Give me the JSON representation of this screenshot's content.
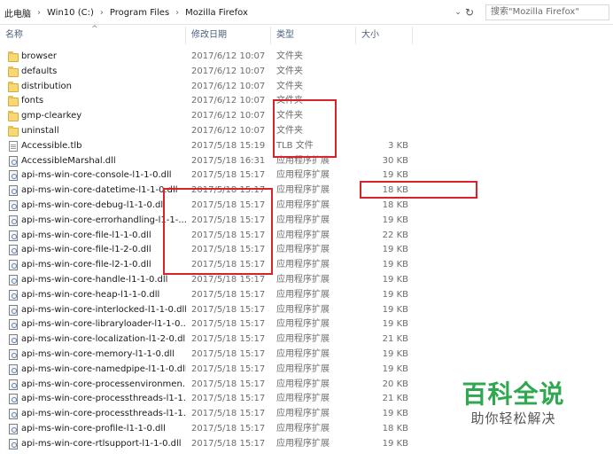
{
  "address_bar": {
    "breadcrumbs": [
      "此电脑",
      "Win10 (C:)",
      "Program Files",
      "Mozilla Firefox"
    ],
    "separator": "›",
    "dropdown_icon": "chevron-down-icon",
    "refresh_icon": "refresh-icon",
    "search_placeholder": "搜索\"Mozilla Firefox\""
  },
  "columns": {
    "name": "名称",
    "date": "修改日期",
    "type": "类型",
    "size": "大小",
    "sort_indicator": "^"
  },
  "files": [
    {
      "icon": "folder-icon",
      "name": "browser",
      "date": "2017/6/12 10:07",
      "type": "文件夹",
      "size": ""
    },
    {
      "icon": "folder-icon",
      "name": "defaults",
      "date": "2017/6/12 10:07",
      "type": "文件夹",
      "size": ""
    },
    {
      "icon": "folder-icon",
      "name": "distribution",
      "date": "2017/6/12 10:07",
      "type": "文件夹",
      "size": ""
    },
    {
      "icon": "folder-icon",
      "name": "fonts",
      "date": "2017/6/12 10:07",
      "type": "文件夹",
      "size": ""
    },
    {
      "icon": "folder-icon",
      "name": "gmp-clearkey",
      "date": "2017/6/12 10:07",
      "type": "文件夹",
      "size": ""
    },
    {
      "icon": "folder-icon",
      "name": "uninstall",
      "date": "2017/6/12 10:07",
      "type": "文件夹",
      "size": ""
    },
    {
      "icon": "file-icon",
      "name": "Accessible.tlb",
      "date": "2017/5/18 15:19",
      "type": "TLB 文件",
      "size": "3 KB"
    },
    {
      "icon": "dll-icon",
      "name": "AccessibleMarshal.dll",
      "date": "2017/5/18 16:31",
      "type": "应用程序扩展",
      "size": "30 KB"
    },
    {
      "icon": "dll-icon",
      "name": "api-ms-win-core-console-l1-1-0.dll",
      "date": "2017/5/18 15:17",
      "type": "应用程序扩展",
      "size": "19 KB"
    },
    {
      "icon": "dll-icon",
      "name": "api-ms-win-core-datetime-l1-1-0.dll",
      "date": "2017/5/18 15:17",
      "type": "应用程序扩展",
      "size": "18 KB"
    },
    {
      "icon": "dll-icon",
      "name": "api-ms-win-core-debug-l1-1-0.dll",
      "date": "2017/5/18 15:17",
      "type": "应用程序扩展",
      "size": "18 KB"
    },
    {
      "icon": "dll-icon",
      "name": "api-ms-win-core-errorhandling-l1-1-...",
      "date": "2017/5/18 15:17",
      "type": "应用程序扩展",
      "size": "19 KB"
    },
    {
      "icon": "dll-icon",
      "name": "api-ms-win-core-file-l1-1-0.dll",
      "date": "2017/5/18 15:17",
      "type": "应用程序扩展",
      "size": "22 KB"
    },
    {
      "icon": "dll-icon",
      "name": "api-ms-win-core-file-l1-2-0.dll",
      "date": "2017/5/18 15:17",
      "type": "应用程序扩展",
      "size": "19 KB"
    },
    {
      "icon": "dll-icon",
      "name": "api-ms-win-core-file-l2-1-0.dll",
      "date": "2017/5/18 15:17",
      "type": "应用程序扩展",
      "size": "19 KB"
    },
    {
      "icon": "dll-icon",
      "name": "api-ms-win-core-handle-l1-1-0.dll",
      "date": "2017/5/18 15:17",
      "type": "应用程序扩展",
      "size": "19 KB"
    },
    {
      "icon": "dll-icon",
      "name": "api-ms-win-core-heap-l1-1-0.dll",
      "date": "2017/5/18 15:17",
      "type": "应用程序扩展",
      "size": "19 KB"
    },
    {
      "icon": "dll-icon",
      "name": "api-ms-win-core-interlocked-l1-1-0.dll",
      "date": "2017/5/18 15:17",
      "type": "应用程序扩展",
      "size": "19 KB"
    },
    {
      "icon": "dll-icon",
      "name": "api-ms-win-core-libraryloader-l1-1-0....",
      "date": "2017/5/18 15:17",
      "type": "应用程序扩展",
      "size": "19 KB"
    },
    {
      "icon": "dll-icon",
      "name": "api-ms-win-core-localization-l1-2-0.dll",
      "date": "2017/5/18 15:17",
      "type": "应用程序扩展",
      "size": "21 KB"
    },
    {
      "icon": "dll-icon",
      "name": "api-ms-win-core-memory-l1-1-0.dll",
      "date": "2017/5/18 15:17",
      "type": "应用程序扩展",
      "size": "19 KB"
    },
    {
      "icon": "dll-icon",
      "name": "api-ms-win-core-namedpipe-l1-1-0.dll",
      "date": "2017/5/18 15:17",
      "type": "应用程序扩展",
      "size": "19 KB"
    },
    {
      "icon": "dll-icon",
      "name": "api-ms-win-core-processenvironmen...",
      "date": "2017/5/18 15:17",
      "type": "应用程序扩展",
      "size": "20 KB"
    },
    {
      "icon": "dll-icon",
      "name": "api-ms-win-core-processthreads-l1-1...",
      "date": "2017/5/18 15:17",
      "type": "应用程序扩展",
      "size": "21 KB"
    },
    {
      "icon": "dll-icon",
      "name": "api-ms-win-core-processthreads-l1-1...",
      "date": "2017/5/18 15:17",
      "type": "应用程序扩展",
      "size": "19 KB"
    },
    {
      "icon": "dll-icon",
      "name": "api-ms-win-core-profile-l1-1-0.dll",
      "date": "2017/5/18 15:17",
      "type": "应用程序扩展",
      "size": "18 KB"
    },
    {
      "icon": "dll-icon",
      "name": "api-ms-win-core-rtlsupport-l1-1-0.dll",
      "date": "2017/5/18 15:17",
      "type": "应用程序扩展",
      "size": "19 KB"
    }
  ],
  "watermark": {
    "title": "百科全说",
    "subtitle": "助你轻松解决"
  },
  "annotation_color": "#d9222a"
}
